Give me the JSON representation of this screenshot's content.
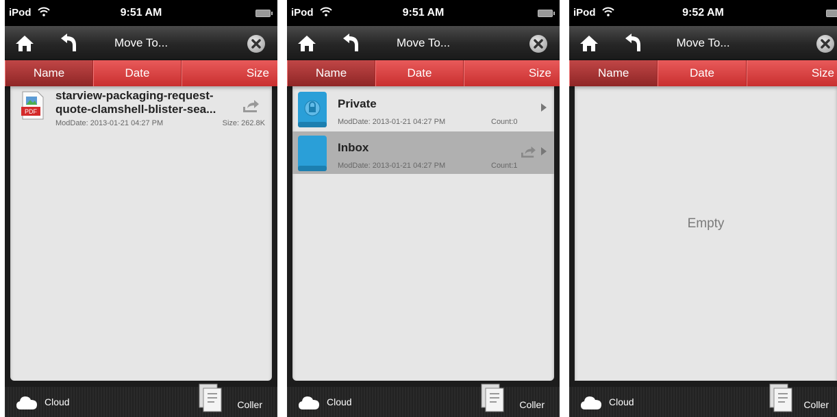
{
  "screens": [
    {
      "status": {
        "carrier": "iPod",
        "time": "9:51 AM"
      },
      "toolbar": {
        "title": "Move To..."
      },
      "tabs": [
        {
          "label": "Name",
          "active": true
        },
        {
          "label": "Date"
        },
        {
          "label": "Size"
        }
      ],
      "file": {
        "name_line1": "starview-packaging-request-",
        "name_line2": "quote-clamshell-blister-sea...",
        "date": "ModDate: 2013-01-21 04:27 PM",
        "size": "Size: 262.8K",
        "icon": "pdf-icon"
      },
      "bottom": {
        "cloud_label": "Cloud",
        "coller_label": "Coller"
      }
    },
    {
      "status": {
        "carrier": "iPod",
        "time": "9:51 AM"
      },
      "toolbar": {
        "title": "Move To..."
      },
      "tabs": [
        {
          "label": "Name",
          "active": true
        },
        {
          "label": "Date"
        },
        {
          "label": "Size"
        }
      ],
      "folders": [
        {
          "name": "Private",
          "date": "ModDate: 2013-01-21 04:27 PM",
          "count": "Count:0",
          "icon": "lock-folder-icon"
        },
        {
          "name": "Inbox",
          "date": "ModDate: 2013-01-21 04:27 PM",
          "count": "Count:1",
          "icon": "folder-icon",
          "selected": true
        }
      ],
      "bottom": {
        "cloud_label": "Cloud",
        "coller_label": "Coller"
      }
    },
    {
      "status": {
        "carrier": "iPod",
        "time": "9:52 AM"
      },
      "toolbar": {
        "title": "Move To..."
      },
      "tabs": [
        {
          "label": "Name",
          "active": true
        },
        {
          "label": "Date"
        },
        {
          "label": "Size"
        }
      ],
      "empty_text": "Empty",
      "bottom": {
        "cloud_label": "Cloud",
        "coller_label": "Coller"
      }
    }
  ],
  "colors": {
    "accent": "#d63b3b",
    "tab_active": "#a53434",
    "toolbar": "#2e2e2e",
    "content_bg": "#e6e6e6",
    "folder_blue": "#2a9fd8"
  }
}
